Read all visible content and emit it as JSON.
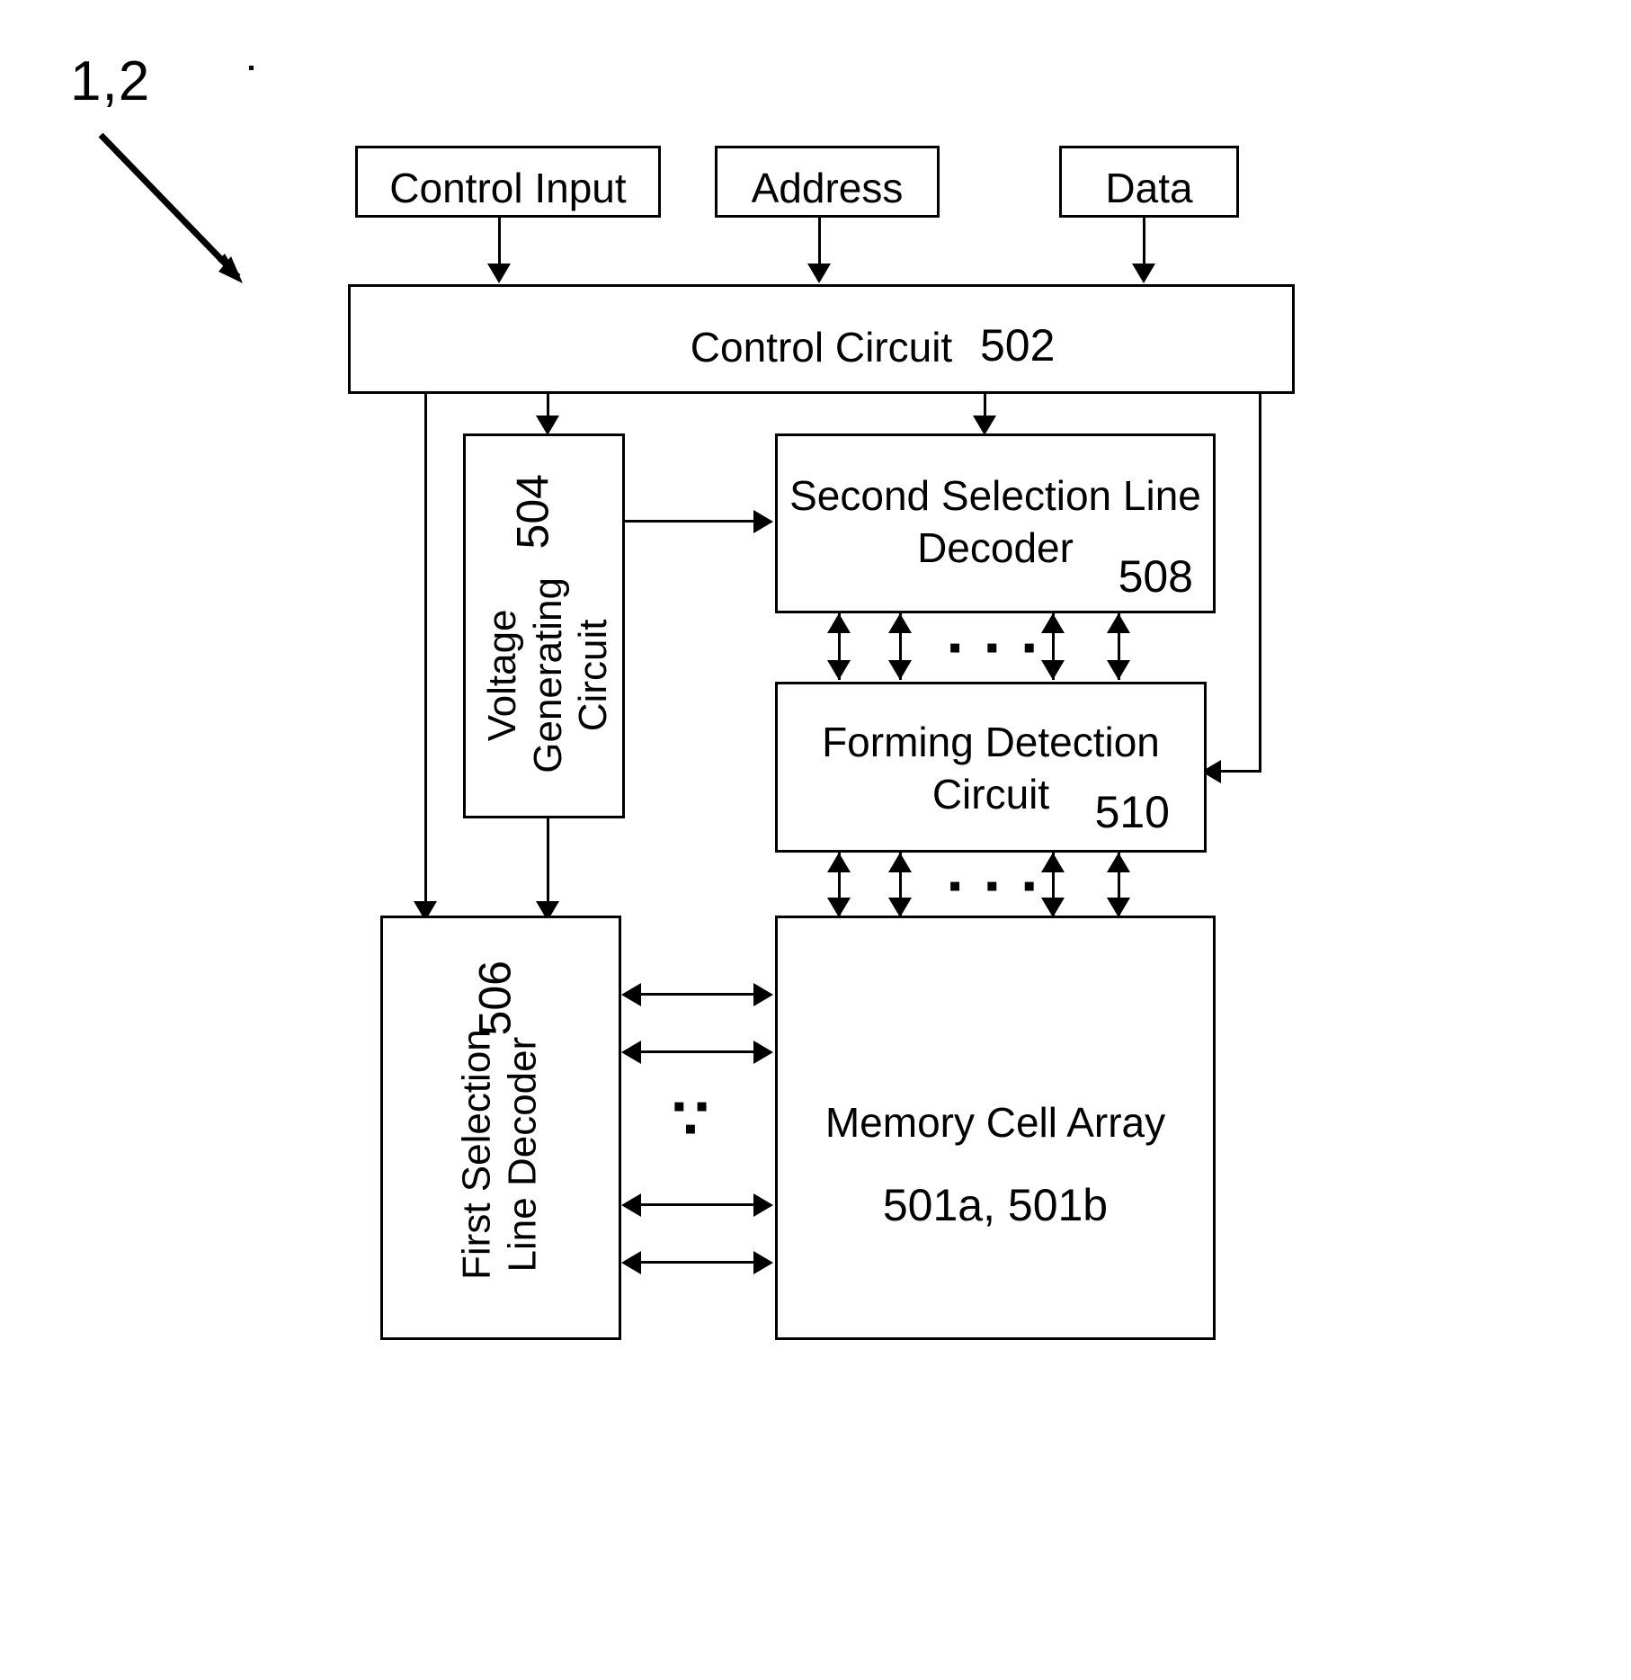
{
  "figure": {
    "reference_numeral": "1,2",
    "type": "patent-block-diagram"
  },
  "blocks": {
    "control_input": {
      "label": "Control Input"
    },
    "address": {
      "label": "Address"
    },
    "data": {
      "label": "Data"
    },
    "control_circuit": {
      "label": "Control Circuit",
      "numeral": "502"
    },
    "voltage_generating_circuit": {
      "label": "Voltage\nGenerating\nCircuit",
      "numeral": "504"
    },
    "second_selection_line_decoder": {
      "label": "Second Selection\nLine Decoder",
      "numeral": "508"
    },
    "forming_detection_circuit": {
      "label": "Forming Detection\nCircuit",
      "numeral": "510"
    },
    "first_selection_line_decoder": {
      "label": "First Selection\nLine Decoder",
      "numeral": "506"
    },
    "memory_cell_array": {
      "label": "Memory Cell Array",
      "numeral": "501a, 501b"
    }
  },
  "ellipses": {
    "between_decoder_and_forming": "▪ ▪ ▪",
    "between_forming_and_array": "▪ ▪ ▪",
    "between_first_decoder_and_array": "▪\n▪\n▪"
  },
  "colors": {
    "stroke": "#000000",
    "background": "#ffffff"
  }
}
